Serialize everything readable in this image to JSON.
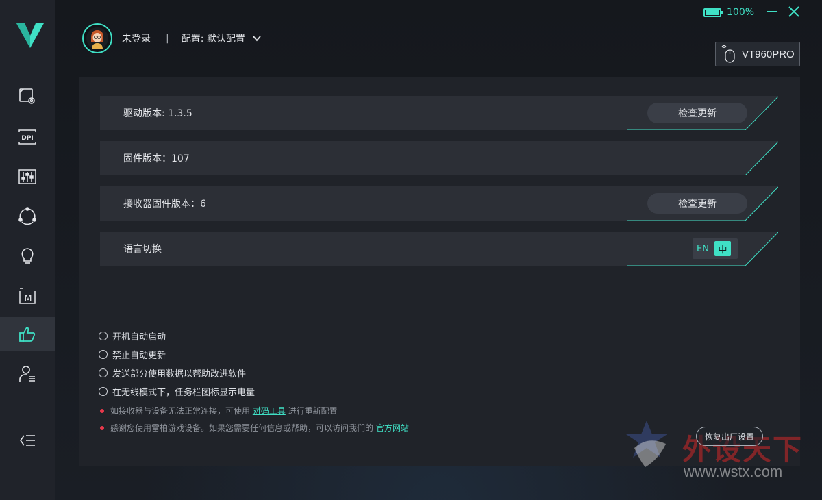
{
  "window": {
    "battery_percent": "100%",
    "minimize_icon": "minimize-icon",
    "close_icon": "close-icon"
  },
  "sidebar": {
    "logo": "v-logo",
    "items": [
      {
        "icon": "screen-settings-icon",
        "label": ""
      },
      {
        "icon": "dpi-icon",
        "label": "DPI"
      },
      {
        "icon": "sliders-icon",
        "label": ""
      },
      {
        "icon": "cycle-icon",
        "label": ""
      },
      {
        "icon": "lightbulb-icon",
        "label": ""
      },
      {
        "icon": "macro-icon",
        "label": "M"
      },
      {
        "icon": "thumbs-up-icon",
        "label": "",
        "active": true
      },
      {
        "icon": "user-list-icon",
        "label": ""
      }
    ],
    "collapse_icon": "collapse-menu-icon"
  },
  "header": {
    "user_status": "未登录",
    "separator": "|",
    "config_label": "配置: 默认配置",
    "device_name": "VT960PRO"
  },
  "settings": {
    "driver_version": "驱动版本: 1.3.5",
    "firmware_version": "固件版本：107",
    "receiver_firmware_version": "接收器固件版本：6",
    "language_switch": "语言切换",
    "check_update": "检查更新",
    "lang_en": "EN",
    "lang_zh": "中"
  },
  "options": [
    "开机自动启动",
    "禁止自动更新",
    "发送部分使用数据以帮助改进软件",
    "在无线模式下，任务栏图标显示电量"
  ],
  "notes": {
    "note1_prefix": "如接收器与设备无法正常连接，可使用 ",
    "note1_link": "对码工具",
    "note1_suffix": " 进行重新配置",
    "note2_prefix": "感谢您使用雷柏游戏设备。如果您需要任何信息或帮助，可以访问我们的 ",
    "note2_link": "官方网站"
  },
  "reset_label": "恢复出厂设置",
  "watermark": {
    "title": "外设天下",
    "url": "www.wstx.com"
  },
  "colors": {
    "accent": "#3fe0c5",
    "panel": "#202329",
    "sidebar": "#20232a",
    "alert_dot": "#e8384b"
  }
}
